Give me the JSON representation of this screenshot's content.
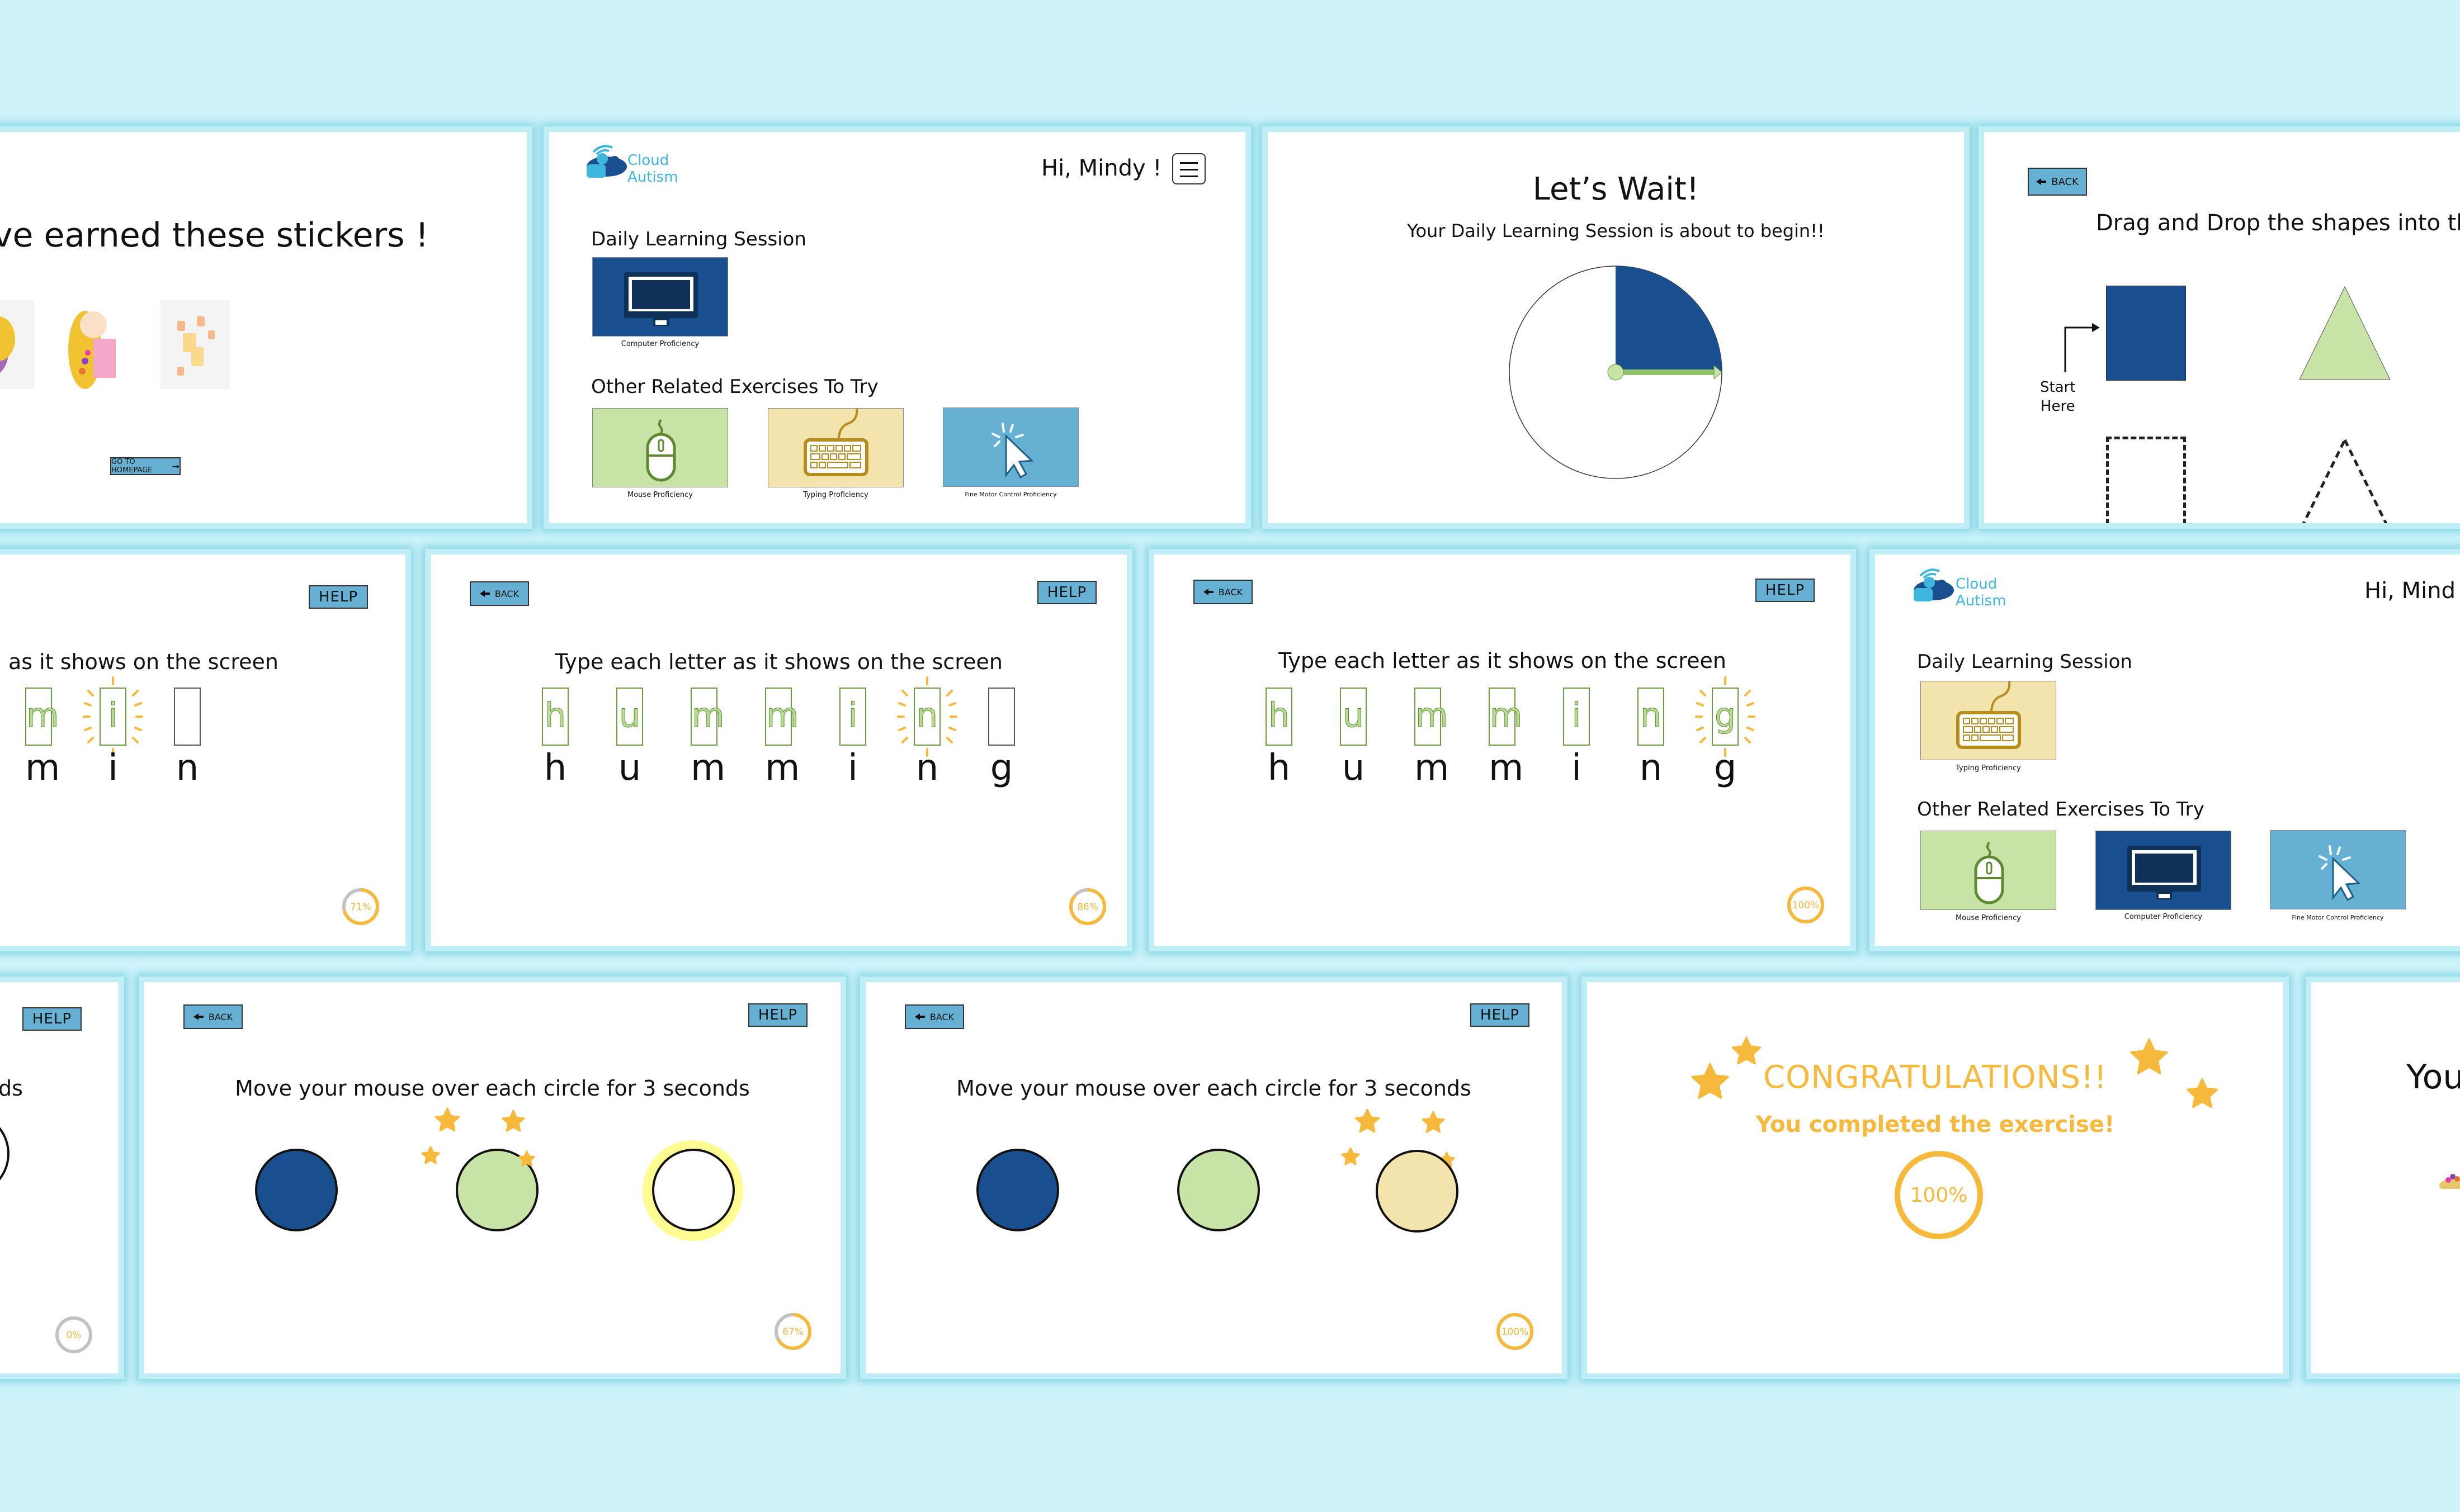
{
  "colors": {
    "background": "#cff3fb",
    "card": "#ffffff",
    "button": "#66b1d3",
    "navy": "#1a4f8f",
    "green": "#c8e3a6",
    "cream": "#f3e4ae",
    "sky": "#66b1d3",
    "gold": "#f6b93b",
    "letter_green": "#b9dc94"
  },
  "stickers_screen": {
    "title": "ve earned these stickers !",
    "stickers": [
      "rapunzel-running-sticker",
      "rapunzel-waving-sticker",
      "lanterns-sticker"
    ],
    "homepage_button": "GO TO HOMEPAGE"
  },
  "home_screen_1": {
    "logo_line1": "Cloud",
    "logo_line2": "Autism",
    "greeting": "Hi, Mindy !",
    "daily_heading": "Daily Learning Session",
    "daily_tiles": [
      {
        "label": "Computer Proficiency",
        "icon": "monitor-icon"
      }
    ],
    "other_heading": "Other Related Exercises To Try",
    "other_tiles": [
      {
        "label": "Mouse Proficiency",
        "icon": "mouse-icon"
      },
      {
        "label": "Typing Proficiency",
        "icon": "keyboard-icon"
      },
      {
        "label": "Fine Motor Control Proficiency",
        "icon": "cursor-click-icon"
      }
    ]
  },
  "wait_screen": {
    "title": "Let’s Wait!",
    "subtitle": "Your Daily Learning Session is about to begin!!",
    "timer_elapsed_fraction": 0.25
  },
  "drag_screen": {
    "back_label": "BACK",
    "instruction": "Drag and Drop the shapes into their",
    "start_label_line1": "Start",
    "start_label_line2": "Here"
  },
  "typing_screen_1": {
    "help_label": "HELP",
    "instruction": "as it shows on the screen",
    "boxes": [
      "m",
      "i",
      ""
    ],
    "letters": [
      "m",
      "i",
      "n"
    ],
    "active_index": 1,
    "progress_label": "71%",
    "progress": 0.71
  },
  "typing_screen_2": {
    "back_label": "BACK",
    "help_label": "HELP",
    "instruction": "Type each letter as it shows on the screen",
    "boxes": [
      "h",
      "u",
      "m",
      "m",
      "i",
      "n",
      ""
    ],
    "letters": [
      "h",
      "u",
      "m",
      "m",
      "i",
      "n",
      "g"
    ],
    "active_index": 5,
    "progress_label": "86%",
    "progress": 0.86
  },
  "typing_screen_3": {
    "back_label": "BACK",
    "help_label": "HELP",
    "instruction": "Type each letter as it shows on the screen",
    "boxes": [
      "h",
      "u",
      "m",
      "m",
      "i",
      "n",
      "g"
    ],
    "letters": [
      "h",
      "u",
      "m",
      "m",
      "i",
      "n",
      "g"
    ],
    "active_index": 6,
    "progress_label": "100%",
    "progress": 1.0
  },
  "home_screen_2": {
    "logo_line1": "Cloud",
    "logo_line2": "Autism",
    "greeting": "Hi, Mind",
    "daily_heading": "Daily Learning Session",
    "daily_tiles": [
      {
        "label": "Typing Proficiency",
        "icon": "keyboard-icon"
      }
    ],
    "other_heading": "Other Related Exercises To Try",
    "other_tiles": [
      {
        "label": "Mouse Proficiency",
        "icon": "mouse-icon"
      },
      {
        "label": "Computer Proficiency",
        "icon": "monitor-icon"
      },
      {
        "label": "Fine Motor Control Proficiency",
        "icon": "cursor-click-icon"
      }
    ]
  },
  "mouse_screen_1": {
    "help_label": "HELP",
    "instruction": "ds",
    "progress_label": "0%",
    "progress": 0
  },
  "mouse_screen_2": {
    "back_label": "BACK",
    "help_label": "HELP",
    "instruction": "Move your mouse over each circle for 3 seconds",
    "circles": [
      "navy",
      "green-done",
      "white-hover"
    ],
    "progress_label": "67%",
    "progress": 0.67
  },
  "mouse_screen_3": {
    "back_label": "BACK",
    "help_label": "HELP",
    "instruction": "Move your mouse over each circle for 3 seconds",
    "circles": [
      "navy",
      "green",
      "cream-done"
    ],
    "progress_label": "100%",
    "progress": 1.0
  },
  "congrats_screen": {
    "title": "CONGRATULATIONS!!",
    "subtitle": "You completed the exercise!",
    "progress_label": "100%",
    "progress": 1.0
  },
  "partial_screen": {
    "title": "You"
  }
}
